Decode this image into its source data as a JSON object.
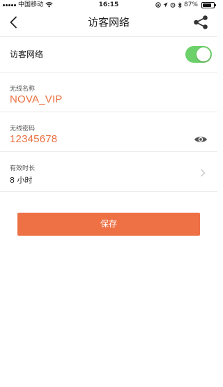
{
  "status_bar": {
    "carrier": "中国移动",
    "time": "16:15",
    "battery": "87%",
    "battery_level": 0.87
  },
  "nav": {
    "title": "访客网络",
    "back_icon": "chevron-left-icon",
    "share_icon": "share-icon"
  },
  "guest_network": {
    "label": "访客网络",
    "enabled": true,
    "toggle_color": "#6cd16a"
  },
  "ssid": {
    "label": "无线名称",
    "value": "NOVA_VIP"
  },
  "password": {
    "label": "无线密码",
    "value": "12345678",
    "toggle_icon": "eye-icon"
  },
  "duration": {
    "label": "有效时长",
    "value": "8 小时"
  },
  "save": {
    "label": "保存"
  },
  "colors": {
    "accent": "#ee7045",
    "value_text": "#e96f3f"
  }
}
